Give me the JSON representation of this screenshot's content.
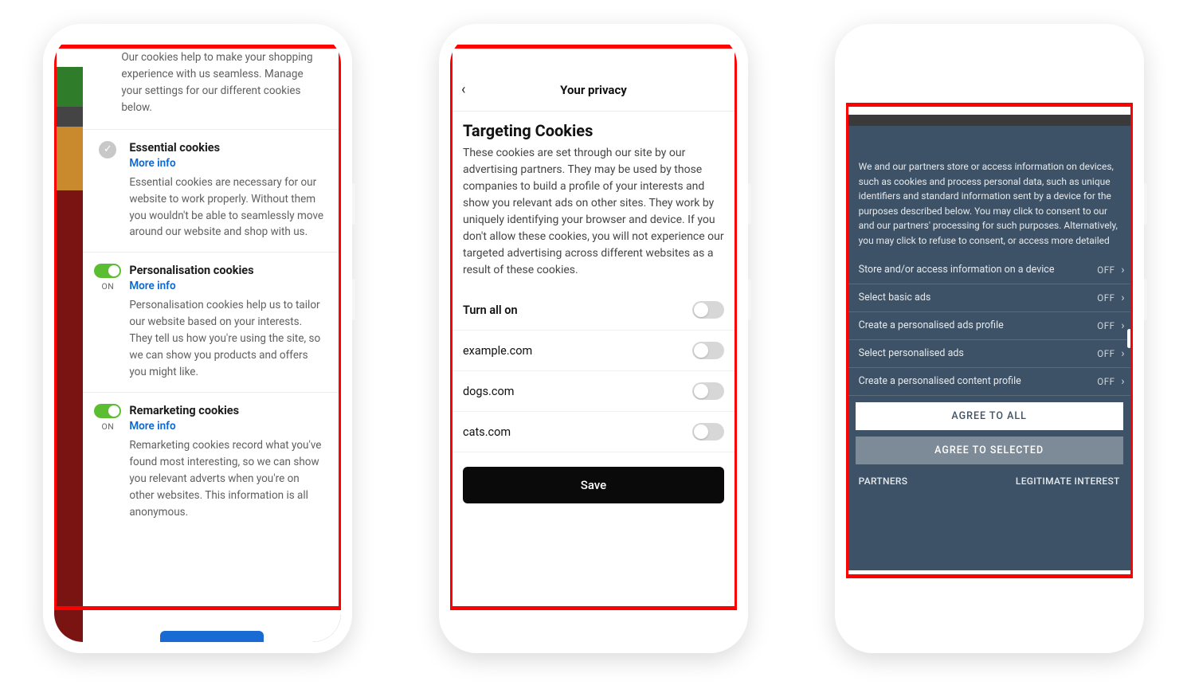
{
  "phone1": {
    "intro": "Our cookies help to make your shopping experience with us seamless. Manage your settings for our different cookies below.",
    "sections": [
      {
        "title": "Essential cookies",
        "more": "More info",
        "desc": "Essential cookies are necessary for our website to work properly. Without them you wouldn't be able to seamlessly move around our website and shop with us."
      },
      {
        "title": "Personalisation cookies",
        "more": "More info",
        "on": "ON",
        "desc": "Personalisation cookies help us to tailor our website based on your interests. They tell us how you're using the site, so we can show you products and offers you might like."
      },
      {
        "title": "Remarketing cookies",
        "more": "More info",
        "on": "ON",
        "desc": "Remarketing cookies record what you've found most interesting, so we can show you relevant adverts when you're on other websites. This information is all anonymous."
      }
    ]
  },
  "phone2": {
    "header": "Your privacy",
    "title": "Targeting Cookies",
    "paragraph": "These cookies are set through our site by our advertising partners. They may be used by those companies to build a profile of your interests and show you relevant ads on other sites. They work by uniquely identifying your browser and device. If you don't allow these cookies, you will not experience our targeted advertising across different websites as a result of these cookies.",
    "rows": [
      {
        "label": "Turn all on",
        "bold": true
      },
      {
        "label": "example.com"
      },
      {
        "label": "dogs.com"
      },
      {
        "label": "cats.com"
      }
    ],
    "save": "Save"
  },
  "phone3": {
    "paragraph": "We and our partners store or access information on devices, such as cookies and process personal data, such as unique identifiers and standard information sent by a device for the purposes described below. You may click to consent to our and our partners' processing for such purposes. Alternatively, you may click to refuse to consent, or access more detailed",
    "options": [
      {
        "label": "Store and/or access information on a device",
        "state": "OFF"
      },
      {
        "label": "Select basic ads",
        "state": "OFF"
      },
      {
        "label": "Create a personalised ads profile",
        "state": "OFF"
      },
      {
        "label": "Select personalised ads",
        "state": "OFF"
      },
      {
        "label": "Create a personalised content profile",
        "state": "OFF"
      }
    ],
    "agree_all": "AGREE TO ALL",
    "agree_selected": "AGREE TO SELECTED",
    "partners": "PARTNERS",
    "legitimate": "LEGITIMATE INTEREST"
  }
}
